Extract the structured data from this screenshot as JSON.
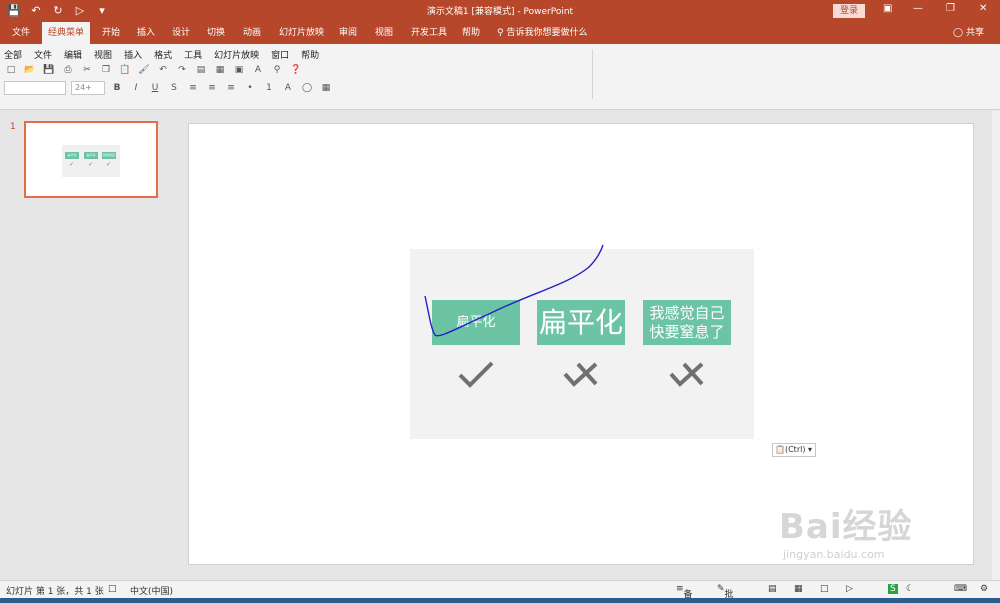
{
  "window": {
    "doc_title": "演示文稿1 [兼容模式] - PowerPoint",
    "login_label": "登录"
  },
  "tabs": [
    {
      "label": "文件",
      "active": false
    },
    {
      "label": "经典菜单",
      "active": true
    },
    {
      "label": "开始",
      "active": false
    },
    {
      "label": "插入",
      "active": false
    },
    {
      "label": "设计",
      "active": false
    },
    {
      "label": "切换",
      "active": false
    },
    {
      "label": "动画",
      "active": false
    },
    {
      "label": "幻灯片放映",
      "active": false
    },
    {
      "label": "审阅",
      "active": false
    },
    {
      "label": "视图",
      "active": false
    },
    {
      "label": "开发工具",
      "active": false
    },
    {
      "label": "帮助",
      "active": false
    }
  ],
  "tellme": "告诉我你想要做什么",
  "share": "共享",
  "menu": [
    "全部",
    "文件",
    "编辑",
    "视图",
    "插入",
    "格式",
    "工具",
    "幻灯片放映",
    "窗口",
    "帮助"
  ],
  "font_size": "24+",
  "thumbnail": {
    "number": "1",
    "box_labels": [
      "扁平化",
      "扁平化",
      "我感觉自己快要窒息了"
    ]
  },
  "slide": {
    "box1": "扁平化",
    "box2": "扁平化",
    "box3_line1": "我感觉自己",
    "box3_line2": "快要窒息了",
    "paste_tag": "(Ctrl)",
    "watermark_main": "Bai经验",
    "watermark_url": "jingyan.baidu.com"
  },
  "status": {
    "slide_info": "幻灯片 第 1 张，共 1 张",
    "language": "中文(中国)",
    "notes": "备注",
    "comments": "批注"
  }
}
